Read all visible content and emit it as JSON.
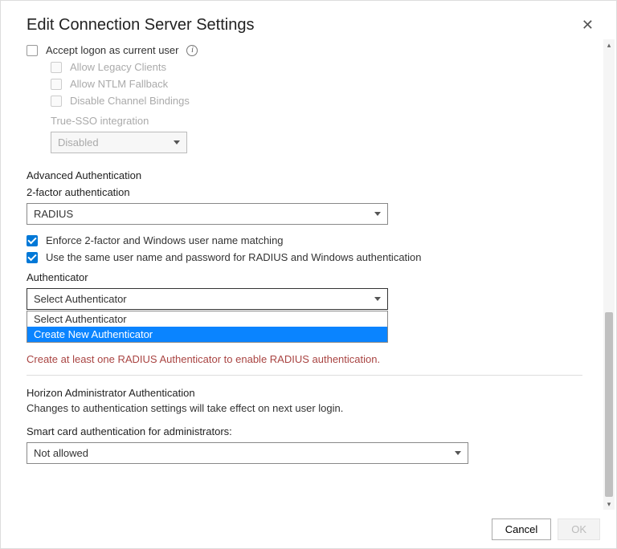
{
  "dialog": {
    "title": "Edit Connection Server Settings"
  },
  "logon": {
    "accept_label": "Accept logon as current user",
    "allow_legacy": "Allow Legacy Clients",
    "allow_ntlm": "Allow NTLM Fallback",
    "disable_channel": "Disable Channel Bindings",
    "true_sso_label": "True-SSO integration",
    "true_sso_value": "Disabled"
  },
  "advanced": {
    "heading": "Advanced Authentication",
    "two_factor_label": "2-factor authentication",
    "two_factor_value": "RADIUS",
    "enforce_label": "Enforce 2-factor and Windows user name matching",
    "same_credentials_label": "Use the same user name and password for RADIUS and Windows authentication",
    "authenticator_label": "Authenticator",
    "authenticator_value": "Select Authenticator",
    "authenticator_options": [
      "Select Authenticator",
      "Create New Authenticator"
    ],
    "warning": "Create at least one RADIUS Authenticator to enable RADIUS authentication."
  },
  "horizon": {
    "heading": "Horizon Administrator Authentication",
    "note": "Changes to authentication settings will take effect on next user login.",
    "smartcard_label": "Smart card authentication for administrators:",
    "smartcard_value": "Not allowed"
  },
  "footer": {
    "cancel": "Cancel",
    "ok": "OK"
  }
}
